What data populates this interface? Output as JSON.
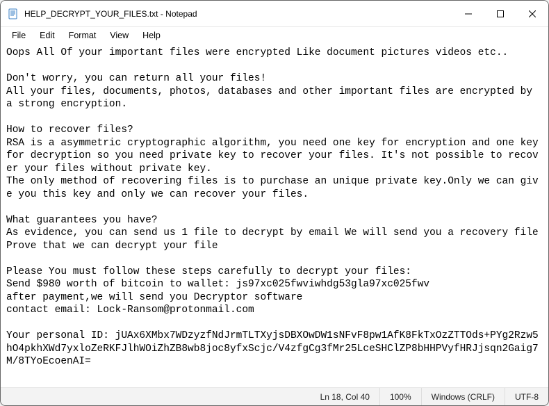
{
  "titlebar": {
    "title": "HELP_DECRYPT_YOUR_FILES.txt - Notepad"
  },
  "menu": {
    "file": "File",
    "edit": "Edit",
    "format": "Format",
    "view": "View",
    "help": "Help"
  },
  "editor": {
    "content": "Oops All Of your important files were encrypted Like document pictures videos etc..\n\nDon't worry, you can return all your files!\nAll your files, documents, photos, databases and other important files are encrypted by a strong encryption.\n\nHow to recover files?\nRSA is a asymmetric cryptographic algorithm, you need one key for encryption and one key for decryption so you need private key to recover your files. It's not possible to recover your files without private key.\nThe only method of recovering files is to purchase an unique private key.Only we can give you this key and only we can recover your files.\n\nWhat guarantees you have?\nAs evidence, you can send us 1 file to decrypt by email We will send you a recovery file  Prove that we can decrypt your file\n\nPlease You must follow these steps carefully to decrypt your files:\nSend $980 worth of bitcoin to wallet: js97xc025fwviwhdg53gla97xc025fwv\nafter payment,we will send you Decryptor software\ncontact email: Lock-Ransom@protonmail.com\n\nYour personal ID: jUAx6XMbx7WDzyzfNdJrmTLTXyjsDBXOwDW1sNFvF8pw1AfK8FkTxOzZTTOds+PYg2Rzw5hO4pkhXWd7yxloZeRKFJlhWOiZhZB8wb8joc8yfxScjc/V4zfgCg3fMr25LceSHClZP8bHHPVyfHRJjsqn2Gaig7M/8TYoEcoenAI="
  },
  "statusbar": {
    "position": "Ln 18, Col 40",
    "zoom": "100%",
    "lineending": "Windows (CRLF)",
    "encoding": "UTF-8"
  }
}
